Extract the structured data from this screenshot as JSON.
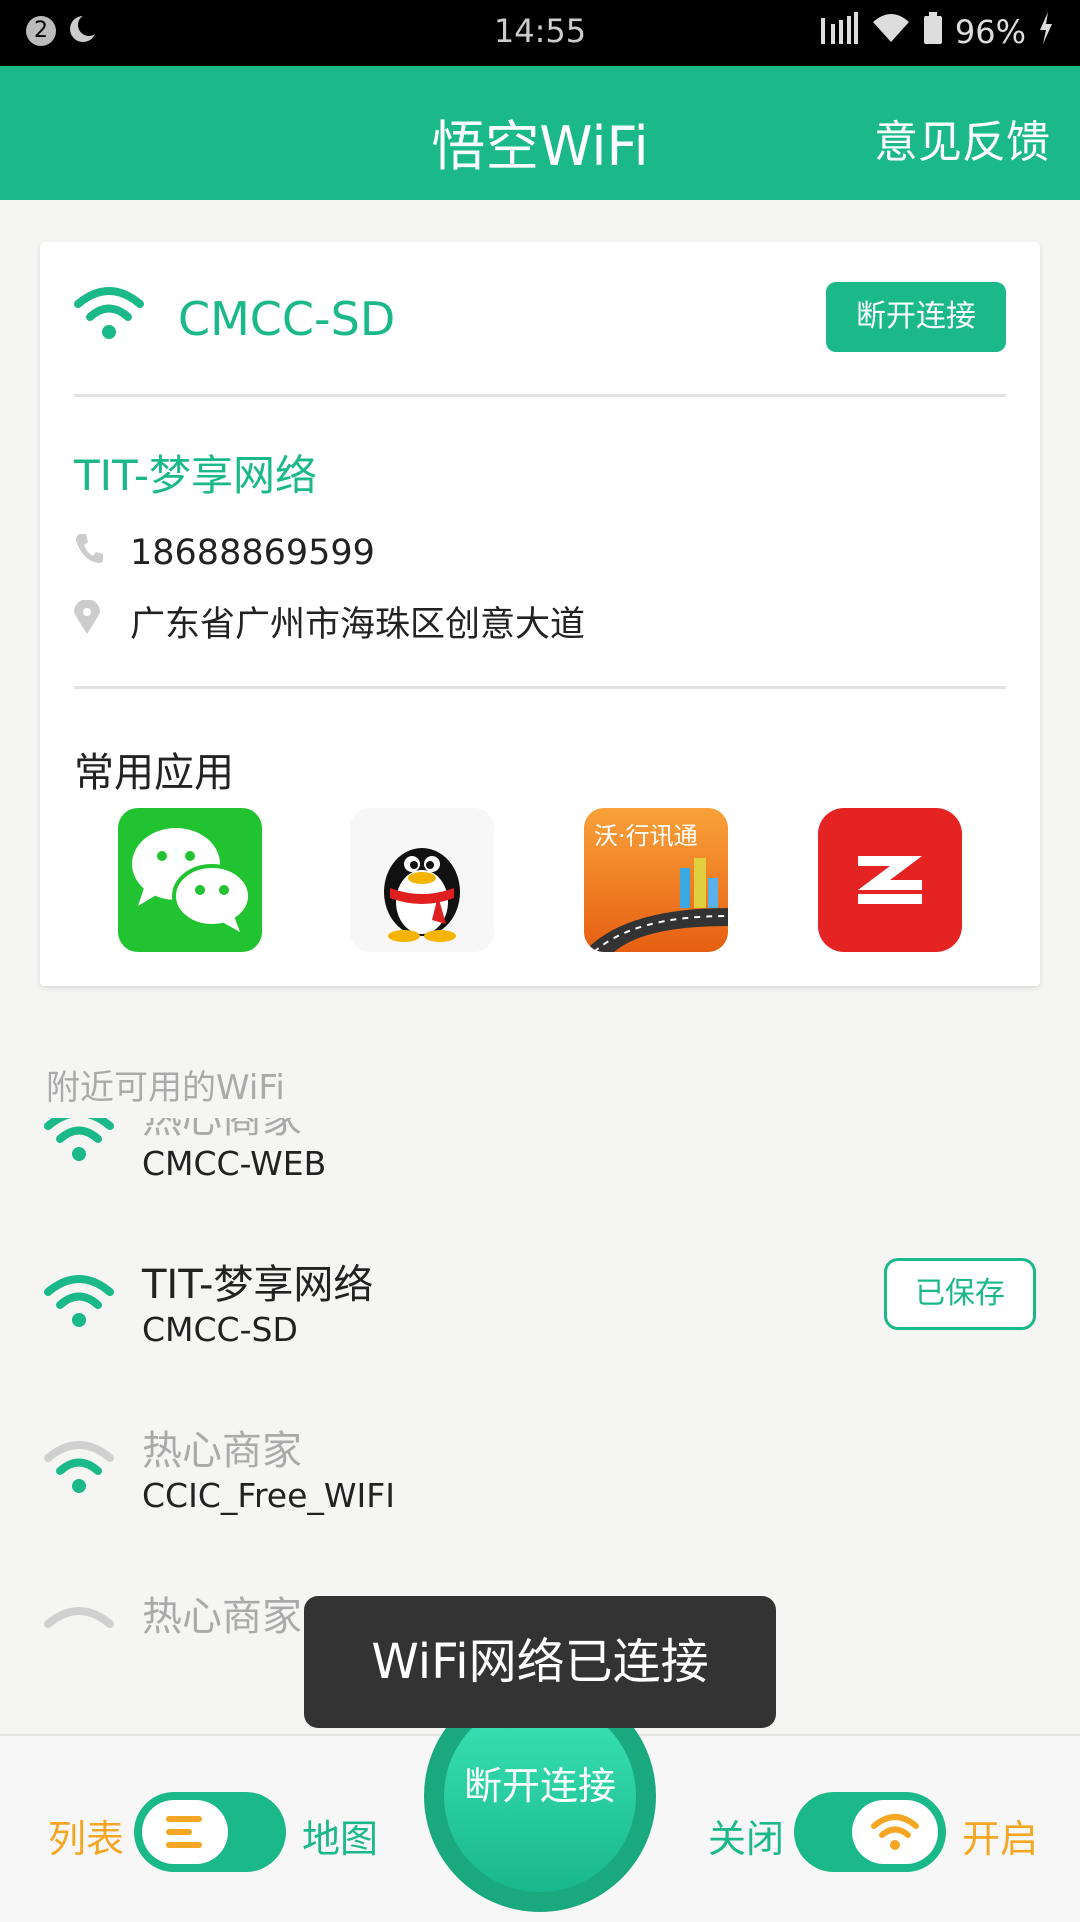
{
  "status_bar": {
    "notification_count": "2",
    "time": "14:55",
    "battery": "96%"
  },
  "app_bar": {
    "title": "悟空WiFi",
    "feedback": "意见反馈"
  },
  "connected_card": {
    "ssid": "CMCC-SD",
    "disconnect_label": "断开连接",
    "merchant_name": "TIT-梦享网络",
    "phone": "18688869599",
    "address": "广东省广州市海珠区创意大道",
    "apps_title": "常用应用",
    "apps": [
      {
        "name": "wechat-icon"
      },
      {
        "name": "qq-icon"
      },
      {
        "name": "wo-travel-icon",
        "text": "沃·行讯通"
      },
      {
        "name": "zaker-icon",
        "text": "Z"
      }
    ]
  },
  "nearby": {
    "label": "附近可用的WiFi",
    "items": [
      {
        "name": "热心商家",
        "ssid": "CMCC-WEB",
        "active": true
      },
      {
        "name": "TIT-梦享网络",
        "ssid": "CMCC-SD",
        "active": true,
        "badge": "已保存"
      },
      {
        "name": "热心商家",
        "ssid": "CCIC_Free_WIFI",
        "active": false
      },
      {
        "name": "热心商家",
        "ssid": "",
        "active": false
      }
    ]
  },
  "toast": "WiFi网络已连接",
  "bottom_bar": {
    "list_label": "列表",
    "map_label": "地图",
    "center_button": "断开连接",
    "off_label": "关闭",
    "on_label": "开启"
  },
  "colors": {
    "primary": "#1bb98a",
    "accent": "#f5a623",
    "grey_wifi": "#cfcfcf"
  }
}
